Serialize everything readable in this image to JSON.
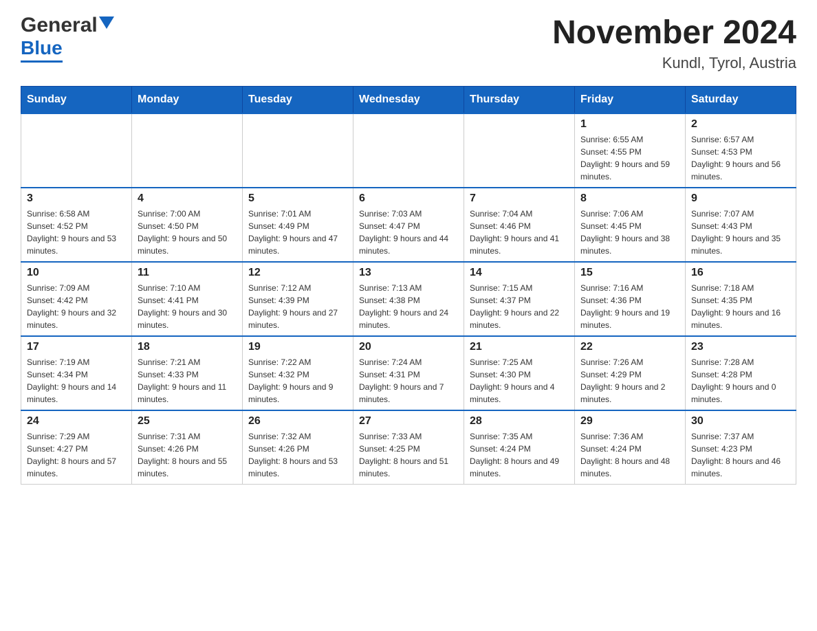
{
  "logo": {
    "general": "General",
    "blue": "Blue"
  },
  "title": "November 2024",
  "subtitle": "Kundl, Tyrol, Austria",
  "days_of_week": [
    "Sunday",
    "Monday",
    "Tuesday",
    "Wednesday",
    "Thursday",
    "Friday",
    "Saturday"
  ],
  "weeks": [
    [
      {
        "day": "",
        "info": ""
      },
      {
        "day": "",
        "info": ""
      },
      {
        "day": "",
        "info": ""
      },
      {
        "day": "",
        "info": ""
      },
      {
        "day": "",
        "info": ""
      },
      {
        "day": "1",
        "info": "Sunrise: 6:55 AM\nSunset: 4:55 PM\nDaylight: 9 hours and 59 minutes."
      },
      {
        "day": "2",
        "info": "Sunrise: 6:57 AM\nSunset: 4:53 PM\nDaylight: 9 hours and 56 minutes."
      }
    ],
    [
      {
        "day": "3",
        "info": "Sunrise: 6:58 AM\nSunset: 4:52 PM\nDaylight: 9 hours and 53 minutes."
      },
      {
        "day": "4",
        "info": "Sunrise: 7:00 AM\nSunset: 4:50 PM\nDaylight: 9 hours and 50 minutes."
      },
      {
        "day": "5",
        "info": "Sunrise: 7:01 AM\nSunset: 4:49 PM\nDaylight: 9 hours and 47 minutes."
      },
      {
        "day": "6",
        "info": "Sunrise: 7:03 AM\nSunset: 4:47 PM\nDaylight: 9 hours and 44 minutes."
      },
      {
        "day": "7",
        "info": "Sunrise: 7:04 AM\nSunset: 4:46 PM\nDaylight: 9 hours and 41 minutes."
      },
      {
        "day": "8",
        "info": "Sunrise: 7:06 AM\nSunset: 4:45 PM\nDaylight: 9 hours and 38 minutes."
      },
      {
        "day": "9",
        "info": "Sunrise: 7:07 AM\nSunset: 4:43 PM\nDaylight: 9 hours and 35 minutes."
      }
    ],
    [
      {
        "day": "10",
        "info": "Sunrise: 7:09 AM\nSunset: 4:42 PM\nDaylight: 9 hours and 32 minutes."
      },
      {
        "day": "11",
        "info": "Sunrise: 7:10 AM\nSunset: 4:41 PM\nDaylight: 9 hours and 30 minutes."
      },
      {
        "day": "12",
        "info": "Sunrise: 7:12 AM\nSunset: 4:39 PM\nDaylight: 9 hours and 27 minutes."
      },
      {
        "day": "13",
        "info": "Sunrise: 7:13 AM\nSunset: 4:38 PM\nDaylight: 9 hours and 24 minutes."
      },
      {
        "day": "14",
        "info": "Sunrise: 7:15 AM\nSunset: 4:37 PM\nDaylight: 9 hours and 22 minutes."
      },
      {
        "day": "15",
        "info": "Sunrise: 7:16 AM\nSunset: 4:36 PM\nDaylight: 9 hours and 19 minutes."
      },
      {
        "day": "16",
        "info": "Sunrise: 7:18 AM\nSunset: 4:35 PM\nDaylight: 9 hours and 16 minutes."
      }
    ],
    [
      {
        "day": "17",
        "info": "Sunrise: 7:19 AM\nSunset: 4:34 PM\nDaylight: 9 hours and 14 minutes."
      },
      {
        "day": "18",
        "info": "Sunrise: 7:21 AM\nSunset: 4:33 PM\nDaylight: 9 hours and 11 minutes."
      },
      {
        "day": "19",
        "info": "Sunrise: 7:22 AM\nSunset: 4:32 PM\nDaylight: 9 hours and 9 minutes."
      },
      {
        "day": "20",
        "info": "Sunrise: 7:24 AM\nSunset: 4:31 PM\nDaylight: 9 hours and 7 minutes."
      },
      {
        "day": "21",
        "info": "Sunrise: 7:25 AM\nSunset: 4:30 PM\nDaylight: 9 hours and 4 minutes."
      },
      {
        "day": "22",
        "info": "Sunrise: 7:26 AM\nSunset: 4:29 PM\nDaylight: 9 hours and 2 minutes."
      },
      {
        "day": "23",
        "info": "Sunrise: 7:28 AM\nSunset: 4:28 PM\nDaylight: 9 hours and 0 minutes."
      }
    ],
    [
      {
        "day": "24",
        "info": "Sunrise: 7:29 AM\nSunset: 4:27 PM\nDaylight: 8 hours and 57 minutes."
      },
      {
        "day": "25",
        "info": "Sunrise: 7:31 AM\nSunset: 4:26 PM\nDaylight: 8 hours and 55 minutes."
      },
      {
        "day": "26",
        "info": "Sunrise: 7:32 AM\nSunset: 4:26 PM\nDaylight: 8 hours and 53 minutes."
      },
      {
        "day": "27",
        "info": "Sunrise: 7:33 AM\nSunset: 4:25 PM\nDaylight: 8 hours and 51 minutes."
      },
      {
        "day": "28",
        "info": "Sunrise: 7:35 AM\nSunset: 4:24 PM\nDaylight: 8 hours and 49 minutes."
      },
      {
        "day": "29",
        "info": "Sunrise: 7:36 AM\nSunset: 4:24 PM\nDaylight: 8 hours and 48 minutes."
      },
      {
        "day": "30",
        "info": "Sunrise: 7:37 AM\nSunset: 4:23 PM\nDaylight: 8 hours and 46 minutes."
      }
    ]
  ]
}
